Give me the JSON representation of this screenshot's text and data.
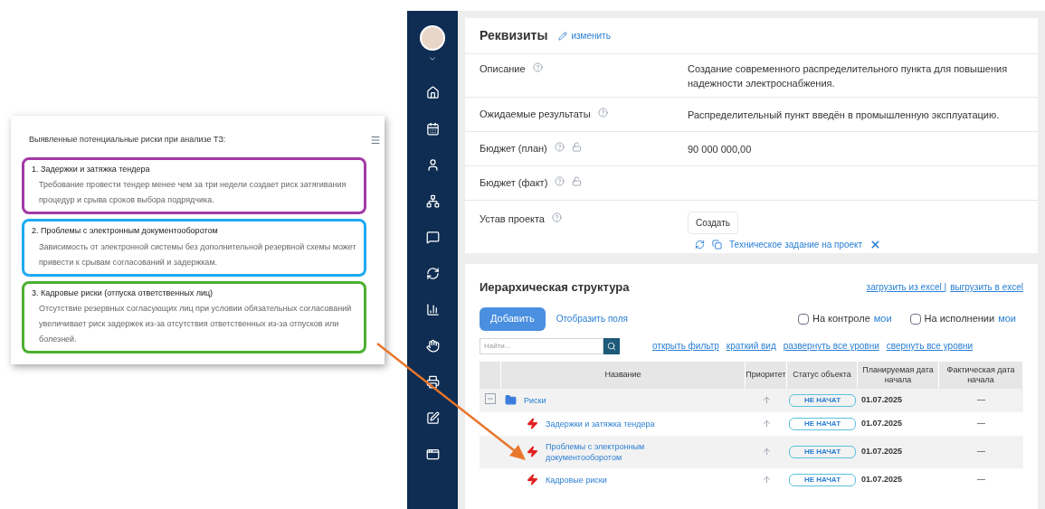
{
  "risk_card": {
    "title": "Выявленные потенциальные риски при анализе ТЗ:",
    "items": [
      {
        "heading": "1. Задержки и затяжка тендера",
        "text": "Требование провести тендер менее чем за три недели создает риск затягивания процедур и срыва сроков выбора подрядчика.",
        "color": "#a23aa6"
      },
      {
        "heading": "2. Проблемы с электронным документооборотом",
        "text": "Зависимость от электронной системы без дополнительной резервной схемы может привести к срывам согласований и задержкам.",
        "color": "#1eaaf1"
      },
      {
        "heading": "3. Кадровые риски (отпуска ответственных лиц)",
        "text": "Отсутствие резервных согласующих лиц при условии обязательных согласований увеличивает риск задержек из-за отсутствия ответственных из-за отпусков или болезней.",
        "color": "#4caf30"
      }
    ]
  },
  "requisites": {
    "title": "Реквизиты",
    "edit_link": "изменить",
    "fields": [
      {
        "label": "Описание",
        "value": "Создание современного распределительного пункта для повышения надежности электроснабжения.",
        "locked": false
      },
      {
        "label": "Ожидаемые результаты",
        "value": "Распределительный пункт введён в промышленную эксплуатацию.",
        "locked": false
      },
      {
        "label": "Бюджет (план)",
        "value": "90 000 000,00",
        "locked": true
      },
      {
        "label": "Бюджет (факт)",
        "locked": true
      }
    ],
    "charter": {
      "label": "Устав проекта",
      "create_button": "Создать",
      "document_link": "Техническое задание на проект"
    }
  },
  "hierarchy": {
    "title": "Иерархическая структура",
    "import_link": "загрузить из excel |",
    "export_link": "выгрузить в excel",
    "add_button": "Добавить",
    "fields_link": "Отобразить поля",
    "filters": [
      {
        "label": "На контроле",
        "link": "мои",
        "checked": false
      },
      {
        "label": "На исполнении",
        "link": "мои",
        "checked": false
      }
    ],
    "search": {
      "placeholder": "Найти..."
    },
    "view_links": [
      "открыть фильтр",
      "краткий вид",
      "развернуть все уровни",
      "свернуть все уровни"
    ],
    "columns": [
      "Название",
      "Приоритет",
      "Статус объекта",
      "Планируемая дата начала",
      "Фактическая дата начала"
    ],
    "rows": [
      {
        "kind": "folder",
        "name": "Риски",
        "status": "НЕ НАЧАТ",
        "planned": "01.07.2025",
        "actual": "—",
        "expanded": true,
        "children": [
          {
            "kind": "risk",
            "name": "Задержки и затяжка тендера",
            "status": "НЕ НАЧАТ",
            "planned": "01.07.2025",
            "actual": "—"
          },
          {
            "kind": "risk",
            "name": "Проблемы с электронным документооборотом",
            "status": "НЕ НАЧАТ",
            "planned": "01.07.2025",
            "actual": "—"
          },
          {
            "kind": "risk",
            "name": "Кадровые риски",
            "status": "НЕ НАЧАТ",
            "planned": "01.07.2025",
            "actual": "—"
          }
        ]
      }
    ]
  }
}
